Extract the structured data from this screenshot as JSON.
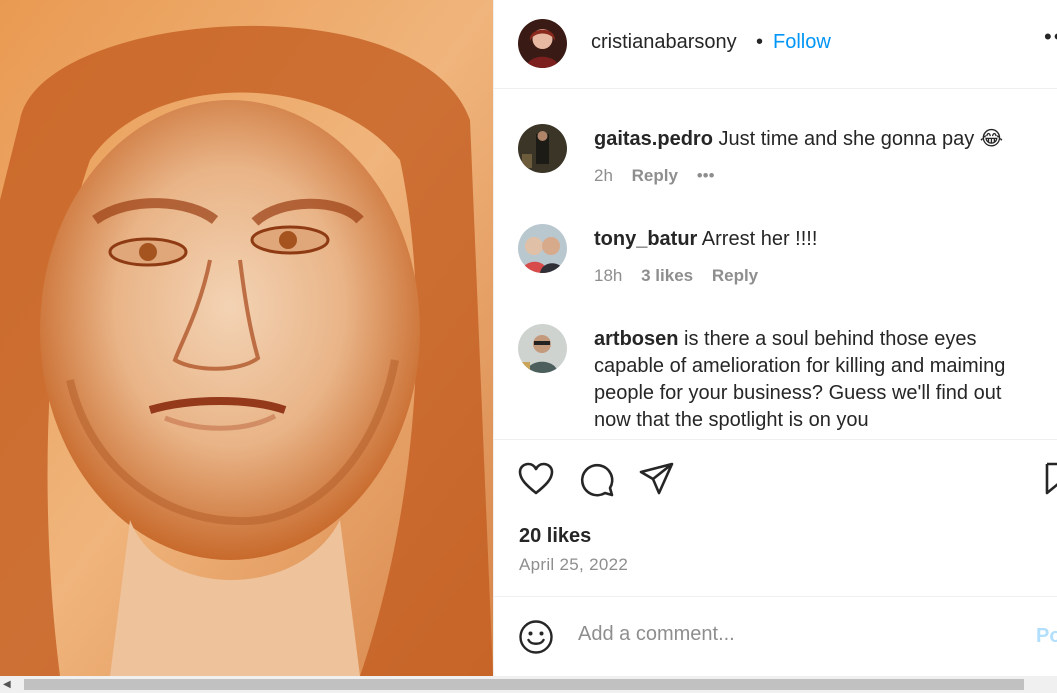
{
  "header": {
    "username": "cristianabarsony",
    "separator": "•",
    "follow_label": "Follow",
    "more_label": "•••"
  },
  "comments": [
    {
      "username": "gaitas.pedro",
      "text": "Just time and she gonna pay 😂",
      "time": "2h",
      "likes": "",
      "reply_label": "Reply",
      "more_label": "•••"
    },
    {
      "username": "tony_batur",
      "text": "Arrest her !!!!",
      "time": "18h",
      "likes": "3 likes",
      "reply_label": "Reply"
    },
    {
      "username": "artbosen",
      "text": "is there a soul behind those eyes capable of amelioration for killing and maiming people for your business? Guess we'll find out now that the spotlight is on you"
    }
  ],
  "post": {
    "likes": "20 likes",
    "date": "April 25, 2022"
  },
  "add_comment": {
    "placeholder": "Add a comment...",
    "post_label": "Post"
  },
  "icons": [
    "heart-icon",
    "comment-icon",
    "share-icon",
    "bookmark-icon",
    "emoji-icon",
    "more-icon"
  ],
  "colors": {
    "follow": "#0095f6",
    "muted": "#8e8e8e",
    "text": "#262626",
    "post_disabled": "#b2dffc",
    "border": "#efefef"
  }
}
